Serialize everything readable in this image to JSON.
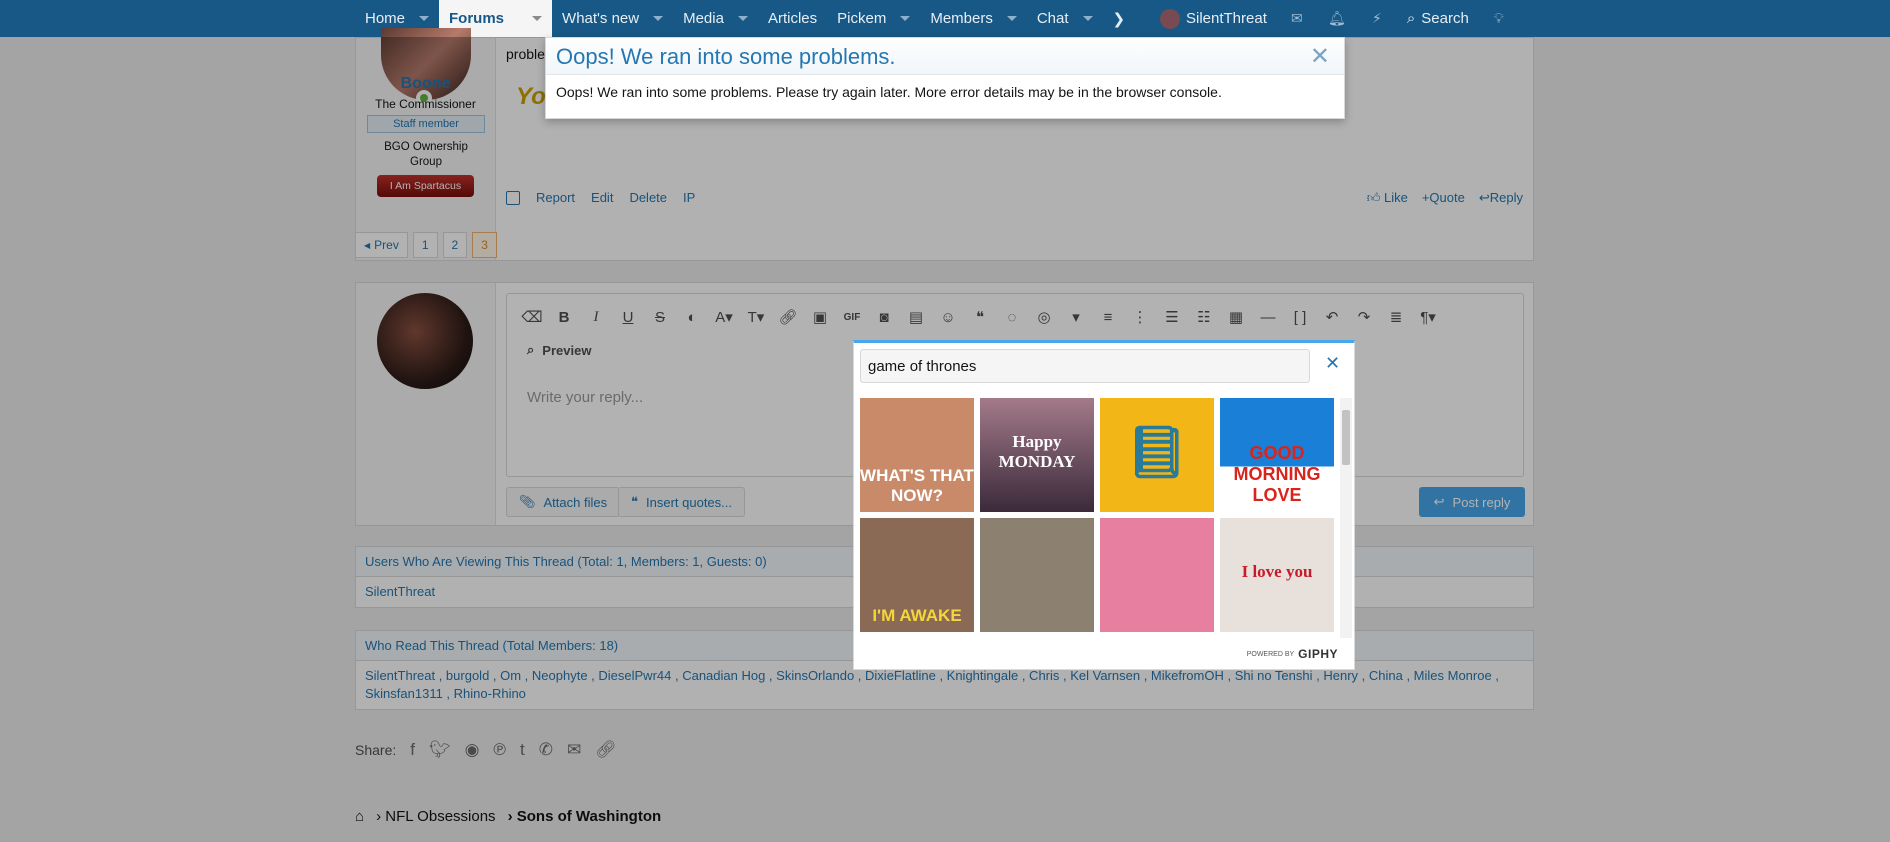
{
  "nav": {
    "items": [
      {
        "label": "Home",
        "dropdown": true
      },
      {
        "label": "Forums",
        "dropdown": true,
        "active": true
      },
      {
        "label": "What's new",
        "dropdown": true
      },
      {
        "label": "Media",
        "dropdown": true
      },
      {
        "label": "Articles",
        "dropdown": false
      },
      {
        "label": "Pickem",
        "dropdown": true
      },
      {
        "label": "Members",
        "dropdown": true
      },
      {
        "label": "Chat",
        "dropdown": true
      }
    ],
    "more_glyph": "❯",
    "username": "SilentThreat",
    "search_label": "Search"
  },
  "post": {
    "author": "Boone",
    "author_title": "The Commissioner",
    "staff_badge": "Staff member",
    "group": "BGO Ownership Group",
    "banner": "I Am Spartacus",
    "message_fragment": "proble",
    "actions_left": [
      "Report",
      "Edit",
      "Delete",
      "IP"
    ],
    "actions_right": [
      "Like",
      "Quote",
      "Reply"
    ]
  },
  "pager": {
    "prev_label": "Prev",
    "pages": [
      "1",
      "2",
      "3"
    ],
    "current": "3"
  },
  "editor": {
    "preview_label": "Preview",
    "placeholder": "Write your reply...",
    "attach_label": "Attach files",
    "insert_quotes_label": "Insert quotes...",
    "post_reply_label": "Post reply"
  },
  "viewing": {
    "header": "Users Who Are Viewing This Thread (Total: 1, Members: 1, Guests: 0)",
    "users": "SilentThreat"
  },
  "read": {
    "header": "Who Read This Thread (Total Members: 18)",
    "line1": "SilentThreat , burgold , Om , Neophyte , DieselPwr44 , Canadian Hog , SkinsOrlando , DixieFlatline , Knightingale , Chris , Kel Varnsen , MikefromOH , Shi no Tenshi , Henry , China , Miles Monroe ,",
    "line2": "Skinsfan1311 , Rhino-Rhino"
  },
  "share": {
    "label": "Share:"
  },
  "breadcrumbs": [
    "NFL Obsessions",
    "Sons of Washington"
  ],
  "error_modal": {
    "title": "Oops! We ran into some problems.",
    "message": "Oops! We ran into some problems. Please try again later. More error details may be in the browser console."
  },
  "giphy": {
    "query": "game of thrones",
    "powered_by": "POWERED BY",
    "brand": "GIPHY",
    "tiles": [
      {
        "caption": "WHAT'S THAT NOW?",
        "bg": "#c98a6a"
      },
      {
        "caption": "Happy MONDAY",
        "bg": "#5a3e4e"
      },
      {
        "caption": "",
        "bg": "#f2b616"
      },
      {
        "caption": "GOOD MORNING LOVE",
        "bg": "#1a7fd6"
      },
      {
        "caption": "I'M AWAKE",
        "bg": "#8a6a55"
      },
      {
        "caption": "",
        "bg": "#8c8070"
      },
      {
        "caption": "",
        "bg": "#e67fa0"
      },
      {
        "caption": "I love you",
        "bg": "#e8e0da"
      }
    ]
  }
}
